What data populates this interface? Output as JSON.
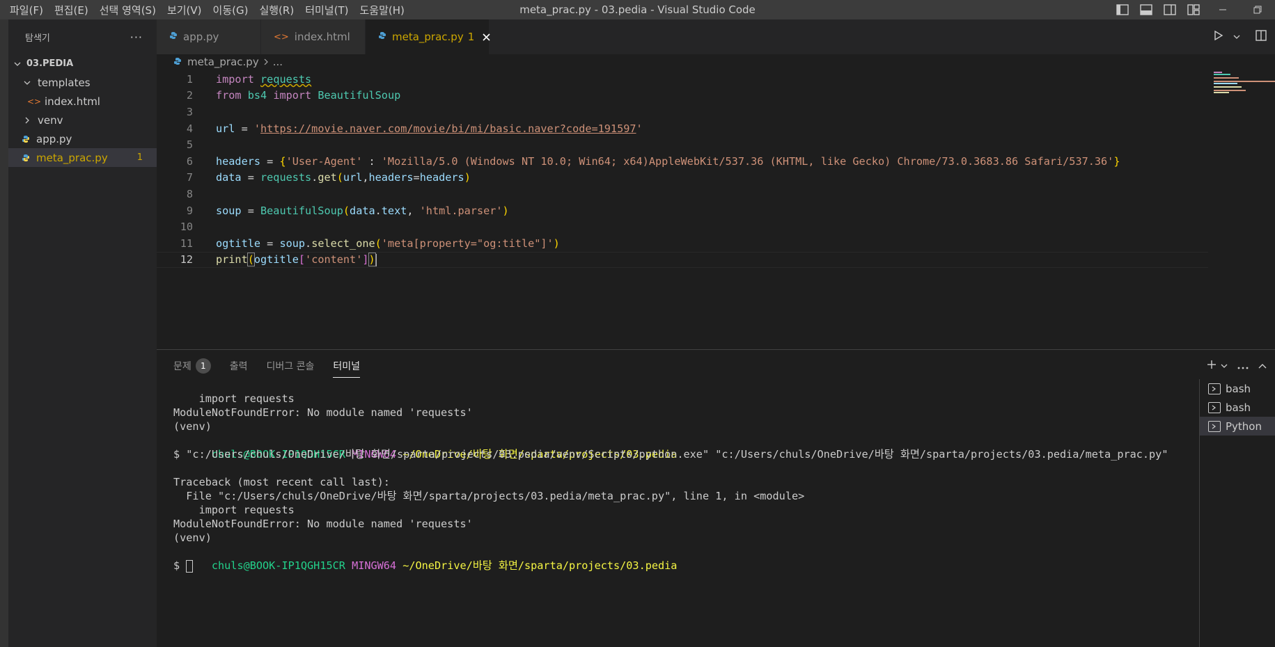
{
  "titlebar": {
    "menus": [
      "파일(F)",
      "편집(E)",
      "선택 영역(S)",
      "보기(V)",
      "이동(G)",
      "실행(R)",
      "터미널(T)",
      "도움말(H)"
    ],
    "window_title": "meta_prac.py - 03.pedia - Visual Studio Code"
  },
  "sidebar": {
    "title": "탐색기",
    "more": "···",
    "root": "03.PEDIA",
    "items": [
      {
        "label": "templates",
        "type": "folder",
        "expanded": true
      },
      {
        "label": "index.html",
        "type": "html"
      },
      {
        "label": "venv",
        "type": "folder",
        "expanded": false
      },
      {
        "label": "app.py",
        "type": "python"
      },
      {
        "label": "meta_prac.py",
        "type": "python",
        "problems": "1"
      }
    ]
  },
  "tabs": [
    {
      "label": "app.py",
      "icon": "python-icon"
    },
    {
      "label": "index.html",
      "icon": "html-icon"
    },
    {
      "label": "meta_prac.py",
      "icon": "python-icon",
      "problems": "1",
      "active": true
    }
  ],
  "breadcrumb": {
    "file": "meta_prac.py",
    "rest": "..."
  },
  "editor": {
    "lines": [
      {
        "n": "1",
        "text": "import requests"
      },
      {
        "n": "2",
        "text": "from bs4 import BeautifulSoup"
      },
      {
        "n": "3",
        "text": ""
      },
      {
        "n": "4",
        "text": "url = 'https://movie.naver.com/movie/bi/mi/basic.naver?code=191597'"
      },
      {
        "n": "5",
        "text": ""
      },
      {
        "n": "6",
        "text": "headers = {'User-Agent' : 'Mozilla/5.0 (Windows NT 10.0; Win64; x64)AppleWebKit/537.36 (KHTML, like Gecko) Chrome/73.0.3683.86 Safari/537.36'}"
      },
      {
        "n": "7",
        "text": "data = requests.get(url,headers=headers)"
      },
      {
        "n": "8",
        "text": ""
      },
      {
        "n": "9",
        "text": "soup = BeautifulSoup(data.text, 'html.parser')"
      },
      {
        "n": "10",
        "text": ""
      },
      {
        "n": "11",
        "text": "ogtitle = soup.select_one('meta[property=\"og:title\"]')"
      },
      {
        "n": "12",
        "text": "print(ogtitle['content'])"
      }
    ],
    "current_line": "12"
  },
  "panel": {
    "tabs": [
      {
        "label": "문제",
        "badge": "1"
      },
      {
        "label": "출력"
      },
      {
        "label": "디버그 콘솔"
      },
      {
        "label": "터미널",
        "active": true
      }
    ],
    "terminal_lines": [
      "    import requests",
      "ModuleNotFoundError: No module named 'requests'",
      "(venv)",
      "$ \"c:/Users/chuls/OneDrive/바탕 화면/sparta/projects/03.pedia/venv/Scripts/python.exe\" \"c:/Users/chuls/OneDrive/바탕 화면/sparta/projects/03.pedia/meta_prac.py\"",
      "",
      "Traceback (most recent call last):",
      "  File \"c:/Users/chuls/OneDrive/바탕 화면/sparta/projects/03.pedia/meta_prac.py\", line 1, in <module>",
      "    import requests",
      "ModuleNotFoundError: No module named 'requests'",
      "(venv)",
      "$ "
    ],
    "prompt": {
      "user": "chuls@BOOK-IP1QGH15CR",
      "host": "MINGW64",
      "path": "~/OneDrive/바탕 화면/sparta/projects/03.pedia"
    },
    "terminals": [
      {
        "label": "bash"
      },
      {
        "label": "bash"
      },
      {
        "label": "Python",
        "active": true
      }
    ]
  }
}
